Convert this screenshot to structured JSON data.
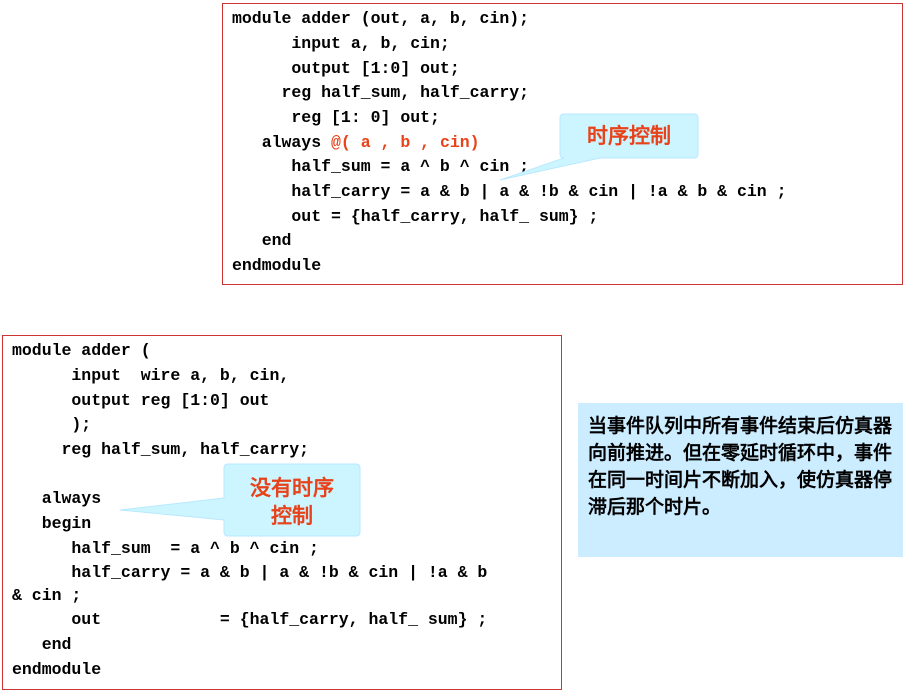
{
  "top_code": {
    "lines": [
      "module adder (out, a, b, cin);",
      "      input a, b, cin;",
      "      output [1:0] out;",
      "     reg half_sum, half_carry;",
      "      reg [1: 0] out;",
      "   always ",
      "      half_sum = a ^ b ^ cin ;",
      "      half_carry = a & b | a & !b & cin | !a & b & cin ;",
      "      out = {half_carry, half_ sum} ;",
      "   end",
      "endmodule"
    ],
    "sensitivity": "@( a , b , cin)"
  },
  "top_callout": {
    "text": "时序控制"
  },
  "bottom_code": {
    "lines": [
      "module adder (",
      "      input  wire a, b, cin,",
      "      output reg [1:0] out",
      "      );",
      "     reg half_sum, half_carry;",
      "",
      "   always",
      "   begin",
      "      half_sum  = a ^ b ^ cin ;",
      "      half_carry = a & b | a & !b & cin | !a & b",
      "& cin ;",
      "      out            = {half_carry, half_ sum} ;",
      "   end",
      "endmodule"
    ]
  },
  "bottom_callout": {
    "text": "没有时序\n控制"
  },
  "note": {
    "text": "当事件队列中所有事件结束后仿真器向前推进。但在零延时循环中，事件在同一时间片不断加入，使仿真器停滞后那个时片。"
  },
  "colors": {
    "box_border": "#cc3333",
    "highlight_red": "#e8421a",
    "callout_fill": "#ccf5ff",
    "note_fill": "#ccecff"
  }
}
